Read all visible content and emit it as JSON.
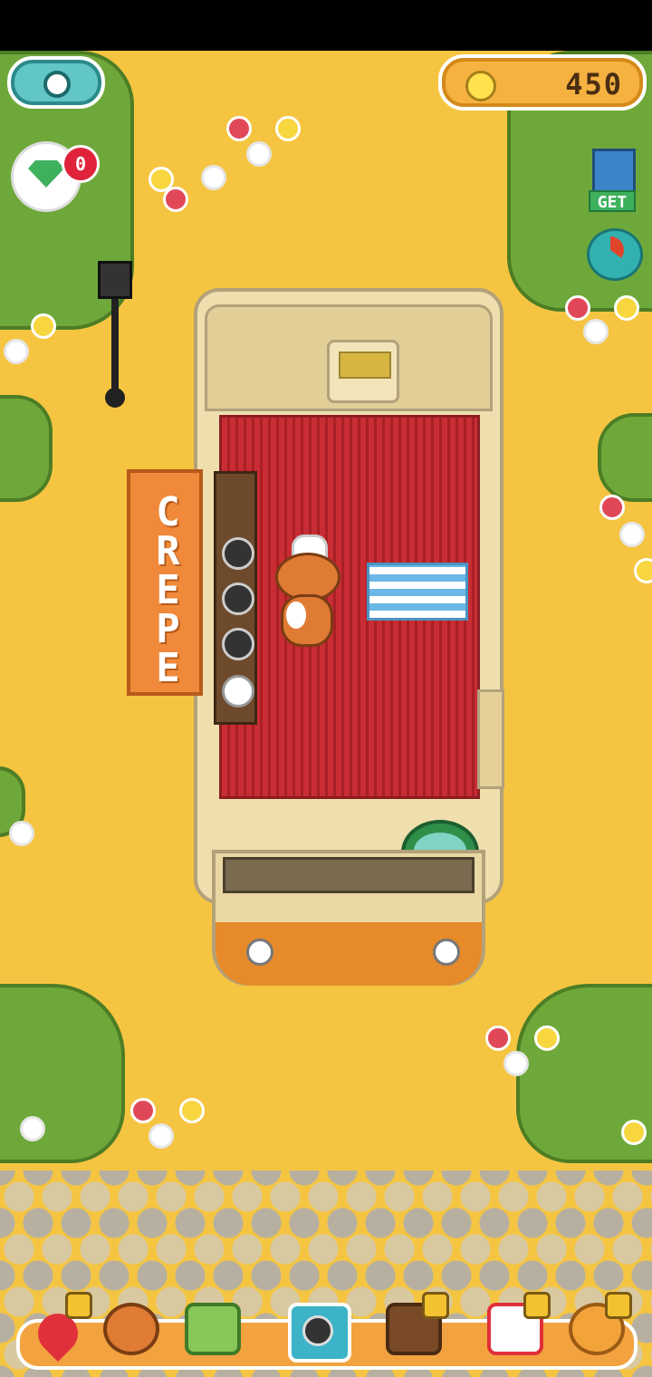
{
  "hud": {
    "coins": "450",
    "gem_notifications": "0",
    "get_label": "GET"
  },
  "truck": {
    "sign_text": "CREPE"
  },
  "icons": {
    "settings": "gear-icon",
    "gem": "gem-icon",
    "coin": "coin-icon",
    "get": "capsule-machine-icon",
    "stats": "pie-chart-icon"
  },
  "bottom_bar": {
    "items": [
      {
        "name": "map-pin",
        "locked": true
      },
      {
        "name": "shiba-dog",
        "locked": false
      },
      {
        "name": "cash-register",
        "locked": false
      },
      {
        "name": "camera",
        "locked": false
      },
      {
        "name": "sofa",
        "locked": true
      },
      {
        "name": "truck-shop",
        "locked": true
      },
      {
        "name": "bag",
        "locked": true
      }
    ]
  },
  "colors": {
    "ground": "#f5c542",
    "grass": "#6fa83a",
    "truck_accent": "#e68a2a",
    "floor": "#c92d33",
    "badge": "#e0233a"
  }
}
